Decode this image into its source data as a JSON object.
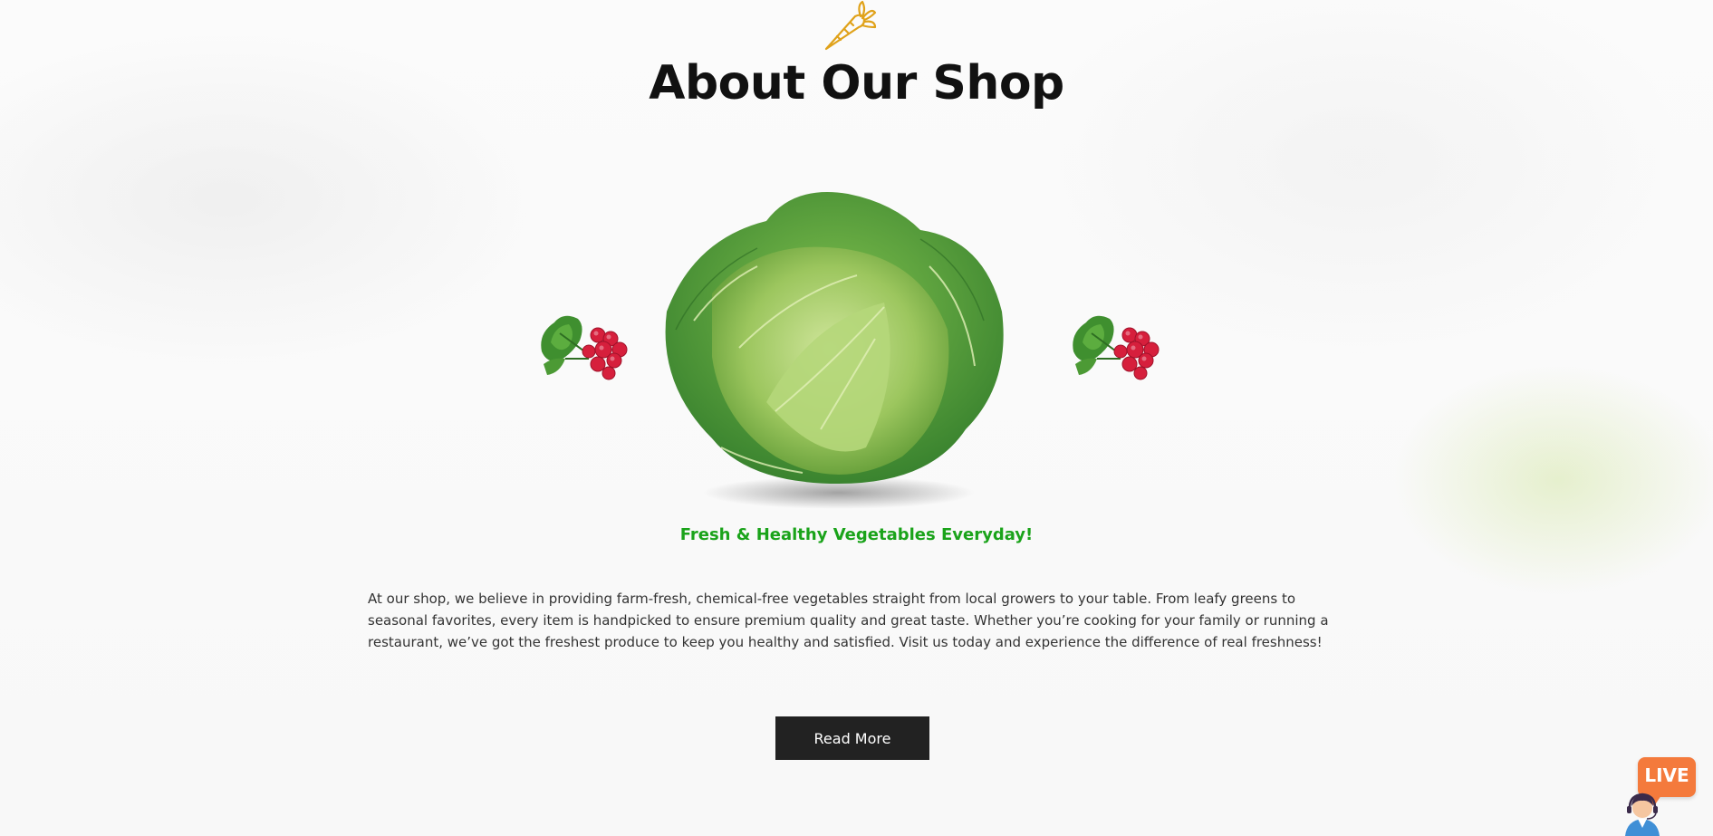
{
  "section": {
    "title": "About Our Shop",
    "tagline": "Fresh & Healthy Vegetables Everyday!",
    "description": "At our shop, we believe in providing farm-fresh, chemical-free vegetables straight from local growers to your table. From leafy greens to seasonal favorites, every item is handpicked to ensure premium quality and great taste. Whether you’re cooking for your family or running a restaurant, we’ve got the freshest produce to keep you healthy and satisfied. Visit us today and experience the difference of real freshness!",
    "read_more_label": "Read More"
  },
  "live_chat": {
    "badge": "LIVE"
  },
  "icons": {
    "header_icon": "carrot-icon",
    "chat_icon": "support-agent-icon"
  },
  "colors": {
    "tagline": "#1aa31a",
    "button_bg": "#222222",
    "live_badge": "#f47a3c",
    "carrot_outline": "#e0a21a"
  }
}
